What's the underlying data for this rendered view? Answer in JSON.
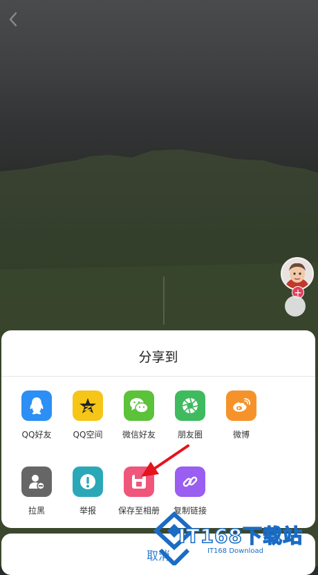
{
  "colors": {
    "qq": "#2b8ff5",
    "qzone": "#f5c518",
    "wechat": "#5bc23a",
    "moments": "#3fba5e",
    "weibo": "#f5932a",
    "blacklist": "#666666",
    "report": "#2aa8b8",
    "save": "#f0557a",
    "copy": "#9a5ef0",
    "cancel": "#2f7fd6",
    "arrow": "#e3141c",
    "watermark": "#1a6cc4"
  },
  "nav": {
    "back_icon": "chevron-left-icon"
  },
  "sheet": {
    "title": "分享到",
    "row1": [
      {
        "label": "QQ好友",
        "icon": "qq-penguin-icon"
      },
      {
        "label": "QQ空间",
        "icon": "qzone-star-icon"
      },
      {
        "label": "微信好友",
        "icon": "wechat-icon"
      },
      {
        "label": "朋友圈",
        "icon": "moments-shutter-icon"
      },
      {
        "label": "微博",
        "icon": "weibo-icon"
      }
    ],
    "row2": [
      {
        "label": "拉黑",
        "icon": "block-user-icon"
      },
      {
        "label": "举报",
        "icon": "report-exclamation-icon"
      },
      {
        "label": "保存至相册",
        "icon": "save-disk-icon"
      },
      {
        "label": "复制链接",
        "icon": "link-icon"
      }
    ]
  },
  "cancel": {
    "label": "取消"
  },
  "watermark": {
    "main": "IT168下载站",
    "sub": "IT168 Download"
  }
}
